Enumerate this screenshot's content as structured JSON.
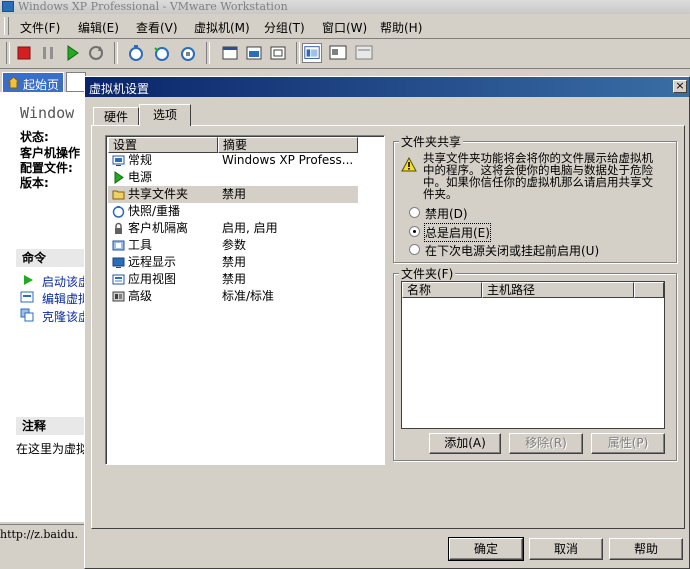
{
  "window": {
    "title": "Windows XP Professional - VMware Workstation"
  },
  "menu": [
    "文件(F)",
    "编辑(E)",
    "查看(V)",
    "虚拟机(M)",
    "分组(T)",
    "窗口(W)",
    "帮助(H)"
  ],
  "toolbar_icons": [
    "stop-icon",
    "pause-icon",
    "play-icon",
    "reset-icon",
    "snapshot-icon",
    "revert-snapshot-icon",
    "manage-snapshots-icon",
    "full-screen-icon",
    "quick-switch-icon",
    "fit-window-icon",
    "normal-view-icon",
    "summary-view-icon",
    "appliance-view-icon"
  ],
  "bg": {
    "home_tab": "起始页",
    "vm_title": "Window",
    "labels": [
      "状态:",
      "客户机操作",
      "配置文件:",
      "版本:"
    ],
    "commands_title": "命令",
    "commands": [
      "启动该虚",
      "编辑虚拟",
      "克隆该虚"
    ],
    "notes_title": "注释",
    "notes_text": "在这里为虚拟",
    "status_url": "http://z.baidu."
  },
  "dialog": {
    "title": "虚拟机设置",
    "tabs": [
      "硬件",
      "选项"
    ],
    "list_headers": [
      "设置",
      "摘要"
    ],
    "items": [
      {
        "name": "常规",
        "summary": "Windows XP Profess...",
        "icon": "general-icon"
      },
      {
        "name": "电源",
        "summary": "",
        "icon": "power-icon"
      },
      {
        "name": "共享文件夹",
        "summary": "禁用",
        "icon": "shared-folder-icon"
      },
      {
        "name": "快照/重播",
        "summary": "",
        "icon": "snapshot-replay-icon"
      },
      {
        "name": "客户机隔离",
        "summary": "启用, 启用",
        "icon": "guest-isolation-icon"
      },
      {
        "name": "工具",
        "summary": "参数",
        "icon": "tools-icon"
      },
      {
        "name": "远程显示",
        "summary": "禁用",
        "icon": "remote-display-icon"
      },
      {
        "name": "应用视图",
        "summary": "禁用",
        "icon": "appliance-view-icon"
      },
      {
        "name": "高级",
        "summary": "标准/标准",
        "icon": "advanced-icon"
      }
    ],
    "selected_index": 2,
    "shared_folders": {
      "title": "文件夹共享",
      "warning": [
        "共享文件夹功能将会将你的文件展示给虚拟机",
        "中的程序。这将会使你的电脑与数据处于危险",
        "中。如果你信任你的虚拟机那么请启用共享文",
        "件夹。"
      ],
      "options": [
        "禁用(D)",
        "总是启用(E)",
        "在下次电源关闭或挂起前启用(U)"
      ],
      "selected_option": 1
    },
    "folders": {
      "title": "文件夹(F)",
      "columns": [
        "名称",
        "主机路径"
      ],
      "buttons": {
        "add": "添加(A)",
        "remove": "移除(R)",
        "properties": "属性(P)"
      }
    },
    "buttons": {
      "ok": "确定",
      "cancel": "取消",
      "help": "帮助"
    }
  }
}
